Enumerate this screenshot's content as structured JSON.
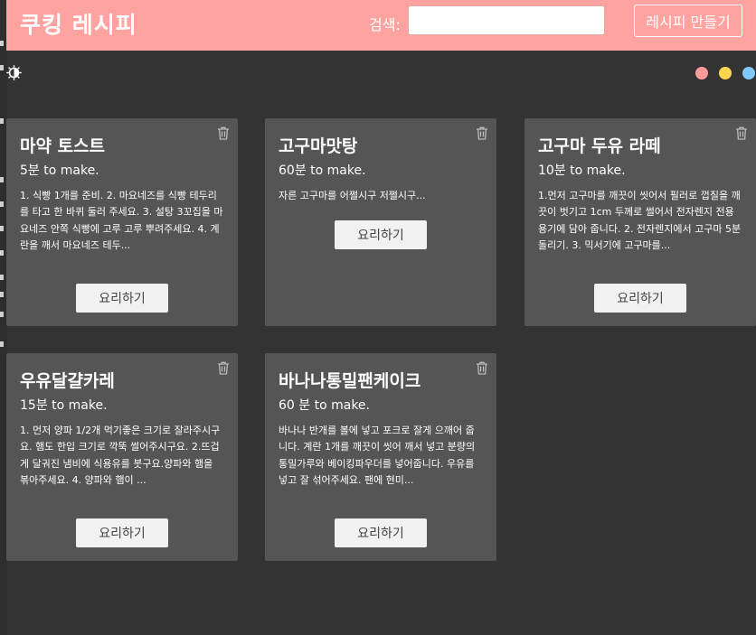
{
  "header": {
    "brand": "쿠킹 레시피",
    "search_label": "검색:",
    "search_value": "",
    "create_label": "레시피 만들기"
  },
  "theme_dots": [
    {
      "name": "theme-dot-pink",
      "color": "#ff9b9b"
    },
    {
      "name": "theme-dot-yellow",
      "color": "#ffd54f"
    },
    {
      "name": "theme-dot-blue",
      "color": "#81c9f8"
    }
  ],
  "recipes": [
    {
      "title": "마약 토스트",
      "time": "5분 to make.",
      "desc": "1. 식빵 1개를 준비. 2. 마요네즈를 식빵 테두리를 타고 한 바퀴 둘러 주세요. 3. 설탕 3꼬집을 마요네즈 안쪽 식빵에 고루 고루 뿌려주세요. 4. 계란을 깨서 마요네즈 테두...",
      "button": "요리하기"
    },
    {
      "title": "고구마맛탕",
      "time": "60분 to make.",
      "desc": "자른 고구마를 어쩔시구 저쩔시구...",
      "button": "요리하기"
    },
    {
      "title": "고구마 두유 라떼",
      "time": "10분 to make.",
      "desc": "1.먼저 고구마를 깨끗이 씻어서 필러로 껍질을 깨끗이 벗기고 1cm 두께로 썰어서 전자렌지 전용 용기에 담아 줍니다. 2. 전자렌지에서 고구마 5분 돌리기. 3. 믹서기에 고구마를...",
      "button": "요리하기"
    },
    {
      "title": "우유달걀카레",
      "time": "15분 to make.",
      "desc": "1. 먼저 양파 1/2개 먹기좋은 크기로 잘라주시구요. 햄도 한입 크기로 깍뚝 썰어주시구요. 2.뜨겁게 달궈진 냄비에 식용유를 붓구요.양파와 햄을 볶아주세요. 4. 양파와 햄이 ...",
      "button": "요리하기"
    },
    {
      "title": "바나나통밀팬케이크",
      "time": "60 분 to make.",
      "desc": "바나나 반개를 볼에 넣고 포크로 잘게 으깨어 줍니다. 계란 1개를 깨끗이 씻어 깨서 넣고 분량의 통밀가루와 베이킹파우더를 넣어줍니다. 우유를 넣고 잘 섞어주세요. 팬에 현미...",
      "button": "요리하기"
    }
  ]
}
